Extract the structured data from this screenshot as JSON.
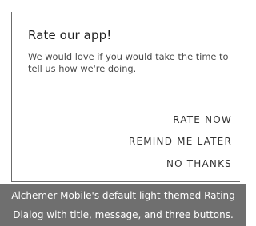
{
  "dialog": {
    "title": "Rate our app!",
    "message": "We would love if you would take the time to tell us how we're doing.",
    "buttons": {
      "rate_now": "RATE NOW",
      "remind_me_later": "REMIND ME LATER",
      "no_thanks": "NO THANKS"
    }
  },
  "caption": {
    "line1": "Alchemer Mobile's default light-themed Rating",
    "line2": "Dialog with title, message, and three buttons."
  },
  "colors": {
    "caption_background": "#6f6f6f",
    "dialog_border": "#6b6b6b"
  }
}
